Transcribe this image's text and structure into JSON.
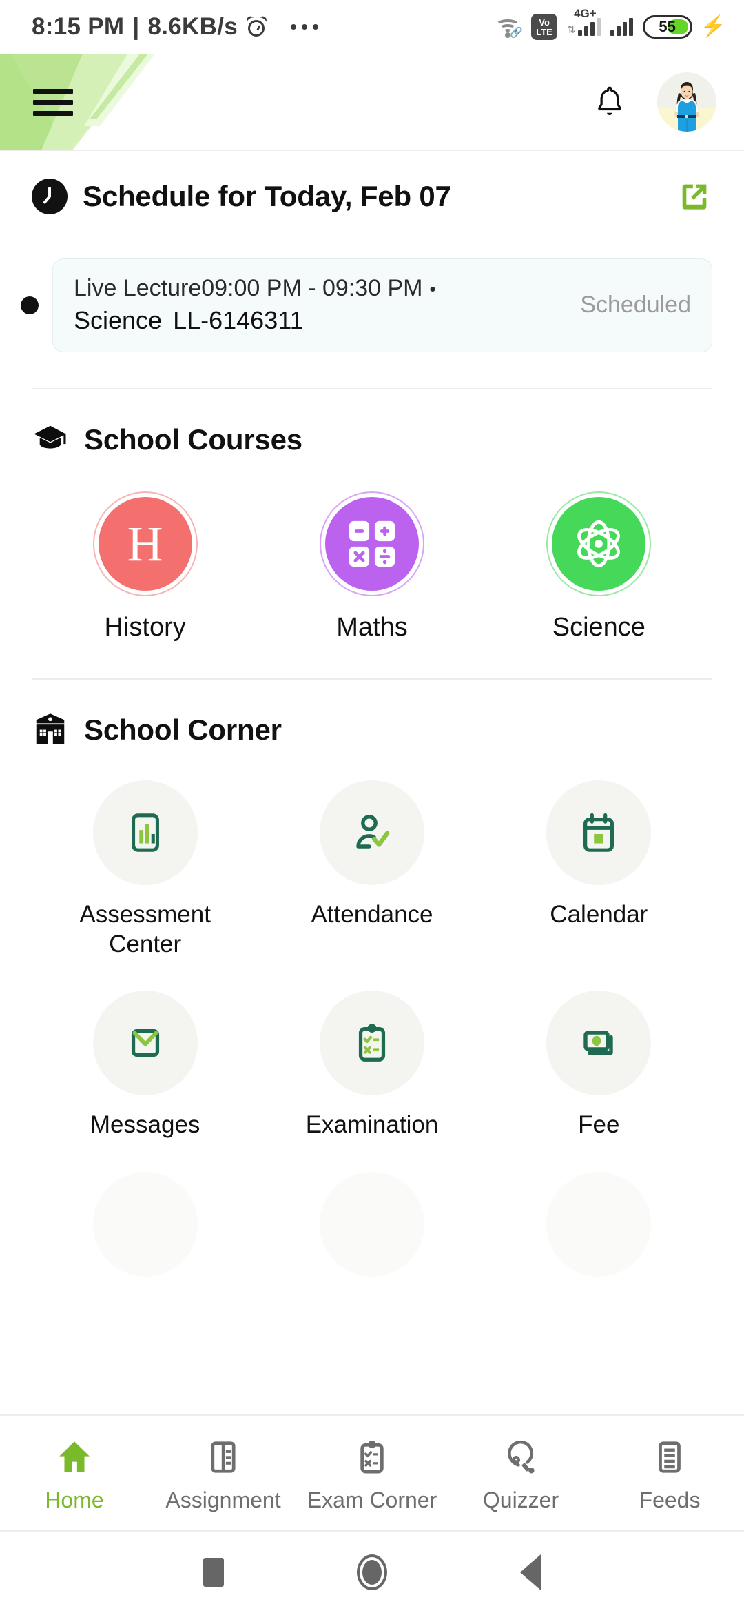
{
  "status_bar": {
    "time": "8:15 PM",
    "separator": "|",
    "network_speed": "8.6KB/s",
    "alarm_icon": "alarm-clock-icon",
    "overflow_icon": "more-dots-icon",
    "wifi_icon": "wifi-icon",
    "volte_top": "Vo",
    "volte_bottom": "LTE",
    "network_type": "4G+",
    "battery_percent": "55",
    "battery_color": "#64d426",
    "charging_icon": "charging-bolt-icon"
  },
  "header": {
    "menu_icon": "hamburger-menu-icon",
    "notification_icon": "bell-icon",
    "avatar_icon": "user-avatar",
    "accent_color": "#7ab929"
  },
  "schedule": {
    "icon": "clock-icon",
    "title": "Schedule for Today, Feb 07",
    "open_icon": "external-link-icon",
    "items": [
      {
        "type": "Live Lecture",
        "time": "09:00 PM - 09:30 PM",
        "separator": "•",
        "subject": "Science",
        "code": "LL-6146311",
        "status": "Scheduled"
      }
    ]
  },
  "school_courses": {
    "icon": "graduation-cap-icon",
    "title": "School Courses",
    "items": [
      {
        "label": "History",
        "glyph": "H",
        "icon": "history-letter-icon",
        "color": "#f4706e",
        "ring": "#f8b4b2"
      },
      {
        "label": "Maths",
        "glyph": "",
        "icon": "calculator-icon",
        "color": "#bb63ef",
        "ring": "#d9a4f6"
      },
      {
        "label": "Science",
        "glyph": "",
        "icon": "atom-icon",
        "color": "#46d959",
        "ring": "#9ae9a4"
      }
    ]
  },
  "school_corner": {
    "icon": "school-building-icon",
    "title": "School Corner",
    "items": [
      {
        "label": "Assessment Center",
        "icon": "assessment-chart-icon"
      },
      {
        "label": "Attendance",
        "icon": "attendance-person-check-icon"
      },
      {
        "label": "Calendar",
        "icon": "calendar-icon"
      },
      {
        "label": "Messages",
        "icon": "envelope-icon"
      },
      {
        "label": "Examination",
        "icon": "clipboard-exam-icon"
      },
      {
        "label": "Fee",
        "icon": "fee-money-icon"
      }
    ]
  },
  "bottom_nav": {
    "active": "Home",
    "items": [
      {
        "label": "Home",
        "icon": "home-icon"
      },
      {
        "label": "Assignment",
        "icon": "assignment-book-icon"
      },
      {
        "label": "Exam Corner",
        "icon": "exam-clipboard-icon"
      },
      {
        "label": "Quizzer",
        "icon": "lightbulb-icon"
      },
      {
        "label": "Feeds",
        "icon": "feeds-list-icon"
      }
    ]
  },
  "android_nav": {
    "recents_icon": "recents-square-icon",
    "home_icon": "home-circle-icon",
    "back_icon": "back-triangle-icon"
  }
}
